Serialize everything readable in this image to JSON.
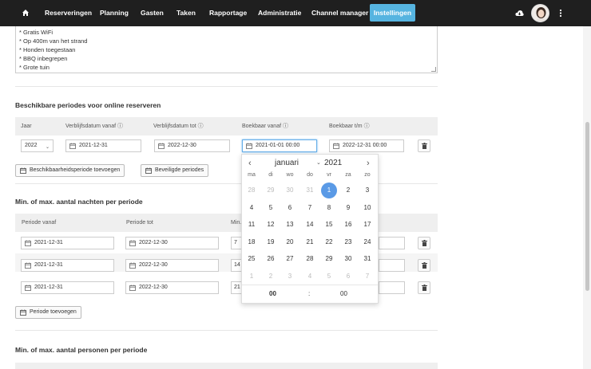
{
  "nav": {
    "items": [
      "Reserveringen",
      "Planning",
      "Gasten",
      "Taken",
      "Rapportage",
      "Administratie",
      "Channel manager"
    ],
    "active": "Instellingen"
  },
  "textarea": {
    "lines": [
      "* Gratis WiFi",
      "* Op 400m van het strand",
      "* Honden toegestaan",
      "* BBQ inbegrepen",
      "* Grote tuin"
    ]
  },
  "periods": {
    "title": "Beschikbare periodes voor online reserveren",
    "headers": {
      "year": "Jaar",
      "from": "Verblijfsdatum vanaf",
      "to": "Verblijfsdatum tot",
      "bookable_from": "Boekbaar vanaf",
      "bookable_to": "Boekbaar t/m"
    },
    "row": {
      "year": "2022",
      "from": "2021-12-31",
      "to": "2022-12-30",
      "bookable_from": "2021-01-01 00:00",
      "bookable_to": "2022-12-31 00:00"
    },
    "add_button": "Beschikbaarheidsperiode toevoegen",
    "secure_button": "Beveiligde periodes"
  },
  "nights": {
    "title": "Min. of max. aantal nachten per periode",
    "headers": {
      "from": "Periode vanaf",
      "to": "Periode tot",
      "min": "Min."
    },
    "rows": [
      {
        "from": "2021-12-31",
        "to": "2022-12-30",
        "min": "7"
      },
      {
        "from": "2021-12-31",
        "to": "2022-12-30",
        "min": "14"
      },
      {
        "from": "2021-12-31",
        "to": "2022-12-30",
        "min": "21"
      }
    ],
    "add_button": "Periode toevoegen"
  },
  "persons": {
    "title": "Min. of max. aantal personen per periode"
  },
  "datepicker": {
    "month": "januari",
    "year": "2021",
    "weekdays": [
      "ma",
      "di",
      "wo",
      "do",
      "vr",
      "za",
      "zo"
    ],
    "days": [
      [
        "28",
        "29",
        "30",
        "31",
        "1",
        "2",
        "3"
      ],
      [
        "4",
        "5",
        "6",
        "7",
        "8",
        "9",
        "10"
      ],
      [
        "11",
        "12",
        "13",
        "14",
        "15",
        "16",
        "17"
      ],
      [
        "18",
        "19",
        "20",
        "21",
        "22",
        "23",
        "24"
      ],
      [
        "25",
        "26",
        "27",
        "28",
        "29",
        "30",
        "31"
      ],
      [
        "1",
        "2",
        "3",
        "4",
        "5",
        "6",
        "7"
      ]
    ],
    "selected": "1",
    "hour": "00",
    "separator": ":",
    "minute": "00",
    "selected_color": "#5a9ae6"
  },
  "colors": {
    "nav_bg": "#1f1f1f",
    "accent": "#56b4e0"
  }
}
